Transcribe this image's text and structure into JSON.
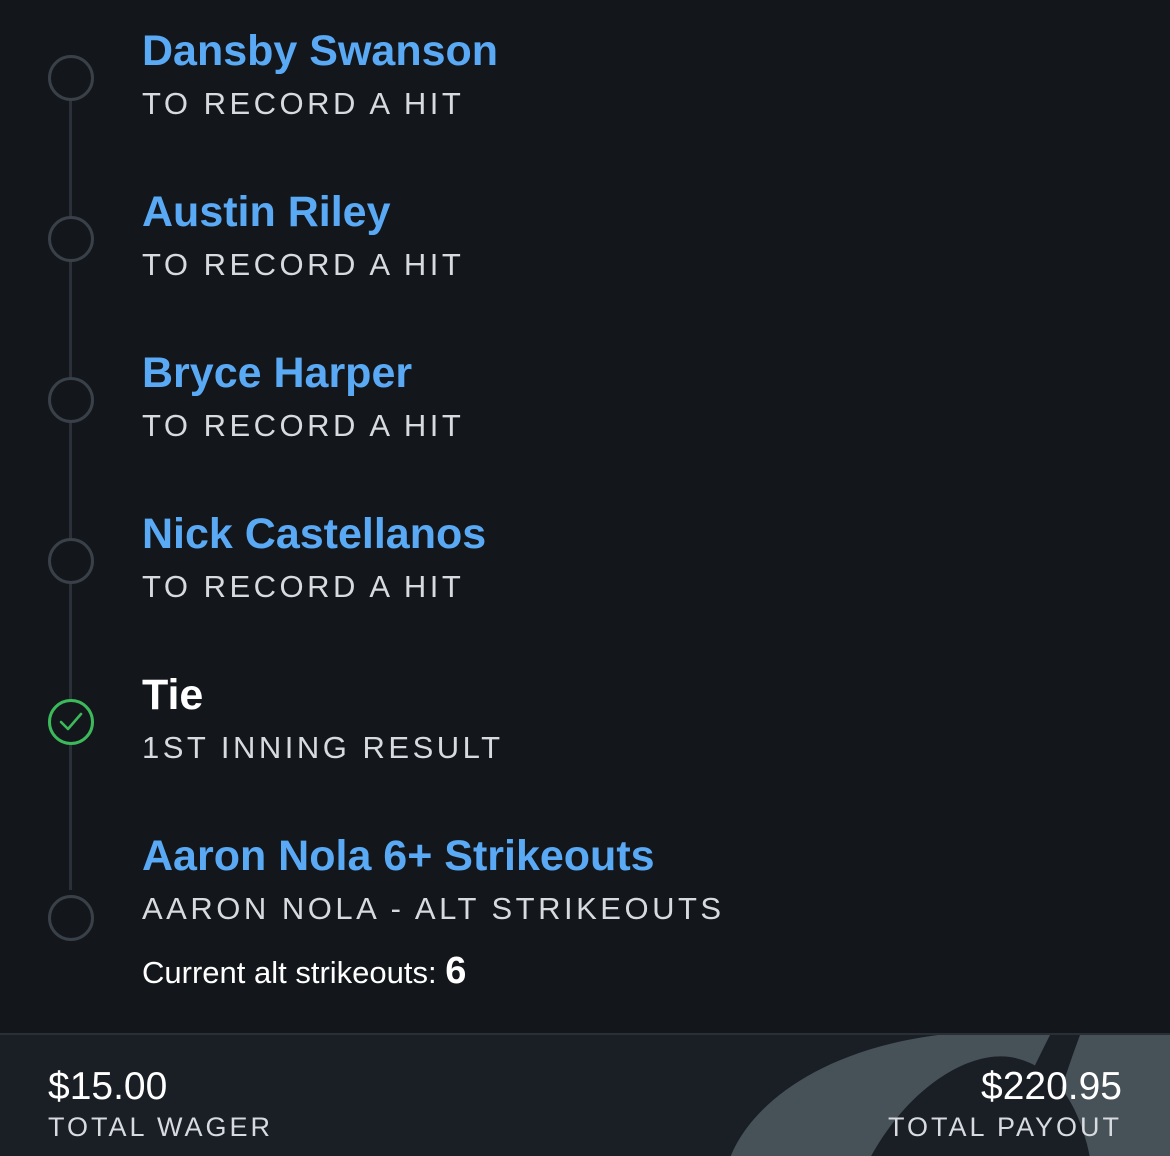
{
  "legs": [
    {
      "title": "Dansby Swanson",
      "market": "TO RECORD A HIT",
      "status": "pending"
    },
    {
      "title": "Austin Riley",
      "market": "TO RECORD A HIT",
      "status": "pending"
    },
    {
      "title": "Bryce Harper",
      "market": "TO RECORD A HIT",
      "status": "pending"
    },
    {
      "title": "Nick Castellanos",
      "market": "TO RECORD A HIT",
      "status": "pending"
    },
    {
      "title": "Tie",
      "market": "1ST INNING RESULT",
      "status": "won"
    },
    {
      "title": "Aaron Nola 6+ Strikeouts",
      "market": "AARON NOLA - ALT STRIKEOUTS",
      "status": "pending",
      "progress_label": "Current alt strikeouts: ",
      "progress_value": "6"
    }
  ],
  "footer": {
    "wager_amount": "$15.00",
    "wager_label": "TOTAL WAGER",
    "payout_amount": "$220.95",
    "payout_label": "TOTAL PAYOUT"
  },
  "colors": {
    "background": "#13171c",
    "link_blue": "#5aa9f5",
    "won_green": "#3cb95a",
    "footer_bg": "#1a1e25"
  },
  "icons": {
    "pending": "empty-circle-icon",
    "won": "check-circle-icon",
    "footer": "brand-watermark-icon"
  }
}
